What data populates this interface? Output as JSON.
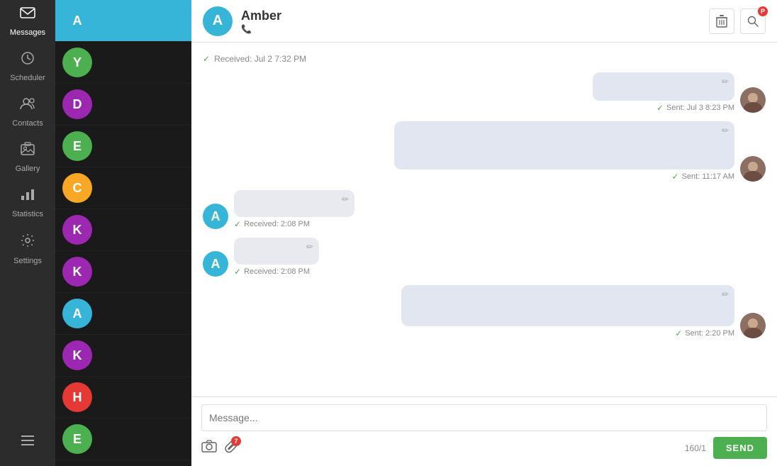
{
  "nav": {
    "items": [
      {
        "id": "messages",
        "label": "Messages",
        "icon": "✉",
        "active": true
      },
      {
        "id": "scheduler",
        "label": "Scheduler",
        "icon": "📅",
        "active": false
      },
      {
        "id": "contacts",
        "label": "Contacts",
        "icon": "👤",
        "active": false
      },
      {
        "id": "gallery",
        "label": "Gallery",
        "icon": "📷",
        "active": false
      },
      {
        "id": "statistics",
        "label": "Statistics",
        "icon": "📊",
        "active": false
      },
      {
        "id": "settings",
        "label": "Settings",
        "icon": "⚙",
        "active": false
      },
      {
        "id": "menu",
        "label": "",
        "icon": "☰",
        "active": false
      }
    ]
  },
  "contacts": [
    {
      "id": "A1",
      "letter": "A",
      "color": "#37b5d8",
      "active": true
    },
    {
      "id": "Y",
      "letter": "Y",
      "color": "#4caf50",
      "active": false
    },
    {
      "id": "D",
      "letter": "D",
      "color": "#9c27b0",
      "active": false
    },
    {
      "id": "E1",
      "letter": "E",
      "color": "#4caf50",
      "active": false
    },
    {
      "id": "C",
      "letter": "C",
      "color": "#f9a825",
      "active": false
    },
    {
      "id": "K1",
      "letter": "K",
      "color": "#9c27b0",
      "active": false
    },
    {
      "id": "K2",
      "letter": "K",
      "color": "#9c27b0",
      "active": false
    },
    {
      "id": "A2",
      "letter": "A",
      "color": "#37b5d8",
      "active": false
    },
    {
      "id": "K3",
      "letter": "K",
      "color": "#9c27b0",
      "active": false
    },
    {
      "id": "H",
      "letter": "H",
      "color": "#e53935",
      "active": false
    },
    {
      "id": "E2",
      "letter": "E",
      "color": "#4caf50",
      "active": false
    }
  ],
  "header": {
    "name": "Amber",
    "letter": "A",
    "avatar_color": "#37b5d8",
    "phone_icon": "📞",
    "delete_icon": "🗑",
    "search_icon": "🔍",
    "badge_label": "P"
  },
  "messages": [
    {
      "id": "m1",
      "type": "received_timestamp",
      "timestamp": "Received: Jul 2 7:32 PM"
    },
    {
      "id": "m2",
      "type": "sent",
      "content": "",
      "timestamp": "Sent: Jul 3 8:23 PM",
      "has_avatar": true
    },
    {
      "id": "m3",
      "type": "sent",
      "content": "",
      "timestamp": "Sent: 11:17 AM",
      "has_avatar": true
    },
    {
      "id": "m4",
      "type": "received",
      "content": "",
      "timestamp": "Received: 2:08 PM",
      "has_letter": "A",
      "letter_color": "#37b5d8"
    },
    {
      "id": "m5",
      "type": "received",
      "content": "",
      "timestamp": "Received: 2:08 PM",
      "has_letter": "A",
      "letter_color": "#37b5d8"
    },
    {
      "id": "m6",
      "type": "sent",
      "content": "",
      "timestamp": "Sent: 2:20 PM",
      "has_avatar": true
    }
  ],
  "input": {
    "placeholder": "Message...",
    "char_count": "160/1",
    "send_label": "SEND",
    "camera_icon": "📷",
    "attach_icon": "📎",
    "badge_label": "7"
  }
}
